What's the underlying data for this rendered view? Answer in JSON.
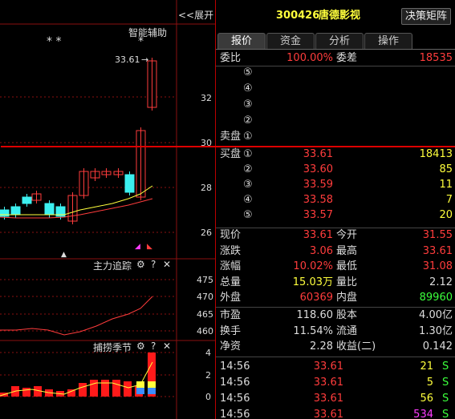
{
  "left": {
    "expand_label": "<<展开",
    "assist_label": "智能辅助",
    "star_marks": [
      "* *",
      "*"
    ],
    "high_label": "33.61",
    "price_ticks": [
      "32",
      "30",
      "28",
      "26"
    ],
    "sub1_title": "主力追踪",
    "sub1_ticks": [
      "475",
      "470",
      "465",
      "460"
    ],
    "sub2_title": "捕捞季节",
    "sub2_ticks": [
      "4",
      "2",
      "0"
    ],
    "icons": {
      "gear": "⚙",
      "help": "?",
      "close": "✕"
    }
  },
  "header": {
    "code": "300426",
    "name": "唐德影视",
    "decision_button": "决策矩阵"
  },
  "tabs": [
    "报价",
    "资金",
    "分析",
    "操作"
  ],
  "commission": {
    "ratio_label": "委比",
    "ratio_value": "100.00%",
    "diff_label": "委差",
    "diff_value": "18535"
  },
  "sell": {
    "label": "卖盘",
    "levels": [
      "⑤",
      "④",
      "③",
      "②",
      "①"
    ]
  },
  "buy": {
    "label": "买盘",
    "rows": [
      {
        "level": "①",
        "price": "33.61",
        "volume": "18413"
      },
      {
        "level": "②",
        "price": "33.60",
        "volume": "85"
      },
      {
        "level": "③",
        "price": "33.59",
        "volume": "11"
      },
      {
        "level": "④",
        "price": "33.58",
        "volume": "7"
      },
      {
        "level": "⑤",
        "price": "33.57",
        "volume": "20"
      }
    ]
  },
  "stats": [
    {
      "l1": "现价",
      "v1": "33.61",
      "c1": "r",
      "l2": "今开",
      "v2": "31.55",
      "c2": "r"
    },
    {
      "l1": "涨跌",
      "v1": "3.06",
      "c1": "r",
      "l2": "最高",
      "v2": "33.61",
      "c2": "r"
    },
    {
      "l1": "涨幅",
      "v1": "10.02%",
      "c1": "r",
      "l2": "最低",
      "v2": "31.08",
      "c2": "r"
    },
    {
      "l1": "总量",
      "v1": "15.03万",
      "c1": "y",
      "l2": "量比",
      "v2": "2.12",
      "c2": "w"
    },
    {
      "l1": "外盘",
      "v1": "60369",
      "c1": "r",
      "l2": "内盘",
      "v2": "89960",
      "c2": "g"
    }
  ],
  "stats2": [
    {
      "l1": "市盈",
      "v1": "118.60",
      "l2": "股本",
      "v2": "4.00亿"
    },
    {
      "l1": "换手",
      "v1": "11.54%",
      "l2": "流通",
      "v2": "1.30亿"
    },
    {
      "l1": "净资",
      "v1": "2.28",
      "l2": "收益(二)",
      "v2": "0.142"
    }
  ],
  "ticks": [
    {
      "time": "14:56",
      "price": "33.61",
      "volume": "21",
      "side": "S",
      "vcolor": "y"
    },
    {
      "time": "14:56",
      "price": "33.61",
      "volume": "5",
      "side": "S",
      "vcolor": "y"
    },
    {
      "time": "14:56",
      "price": "33.61",
      "volume": "56",
      "side": "S",
      "vcolor": "y"
    },
    {
      "time": "14:56",
      "price": "33.61",
      "volume": "534",
      "side": "S",
      "vcolor": "m"
    }
  ],
  "colors": {
    "up": "#ff3c3c",
    "down": "#3cf0f0",
    "ma": "#ffff3c",
    "ma2": "#ff3c3c",
    "grid": "#8a1010",
    "accent_red": "#d00000"
  }
}
